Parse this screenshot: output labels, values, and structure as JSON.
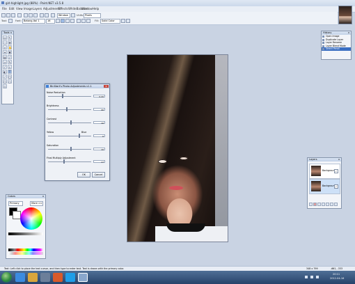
{
  "window": {
    "title": "girl-highlight.jpg (88%) - Paint.NET v3.5.8"
  },
  "menu": [
    "File",
    "Edit",
    "View",
    "Image",
    "Layers",
    "Adjustments",
    "Effects",
    "WhiteBalance",
    "Window",
    "Help"
  ],
  "toolbar": {
    "window_label": "Window",
    "units_label": "Units:",
    "units_value": "Pixels",
    "tool_label": "Tool:",
    "font_label": "Font:",
    "font_value": "Batang-Ital 1",
    "font_size": "16",
    "fill_label": "Fill:",
    "fill_value": "Solid Color",
    "bold": "B",
    "italic": "I",
    "underline": "U"
  },
  "tools_panel": {
    "title": "Tools",
    "icons": [
      "select-rect",
      "move",
      "lasso",
      "move-selection",
      "zoom",
      "pan",
      "magic-wand",
      "paint-bucket",
      "gradient",
      "paintbrush",
      "eraser",
      "pencil",
      "color-picker",
      "clone-stamp",
      "recolor",
      "text",
      "line",
      "rectangle",
      "rounded-rect",
      "ellipse",
      "freeform"
    ]
  },
  "dialog": {
    "title": "BinStart's Photo Adjustments v1.1",
    "close": "x",
    "sliders": [
      {
        "label": "Noise Reduction",
        "value": "0.20"
      },
      {
        "label": "Brightness",
        "value": "40"
      },
      {
        "label": "Contrast",
        "value": "10"
      },
      {
        "label": "Yellow",
        "label_right": "Blue",
        "value": "0"
      },
      {
        "label": "Saturation",
        "value": "10"
      },
      {
        "label": "Final Multiply Adjustment",
        "value": "17"
      }
    ],
    "ok": "OK",
    "cancel": "Cancel"
  },
  "history_panel": {
    "title": "History",
    "items": [
      "Open Image",
      "Duplicate Layer",
      "Layer Rename",
      "Layer Blend Mode",
      "Select Pencil"
    ],
    "selected_index": 4
  },
  "layers_panel": {
    "title": "Layers",
    "layers": [
      {
        "name": "Background 2",
        "selected": false
      },
      {
        "name": "Background",
        "selected": true
      }
    ]
  },
  "colors_panel": {
    "title": "Colors",
    "mode": "Primary",
    "more_label": "More >>"
  },
  "status": {
    "hint": "Text: Left click to place the text cursor, and then type to enter text. Text is drawn with the primary color.",
    "size": "348 x 799",
    "coords": "-661, -333"
  },
  "taskbar": {
    "time": "20:11",
    "date": "2012-04-16"
  },
  "colors": {
    "accent": "#3b6fc2",
    "selection": "#cde0f7"
  }
}
